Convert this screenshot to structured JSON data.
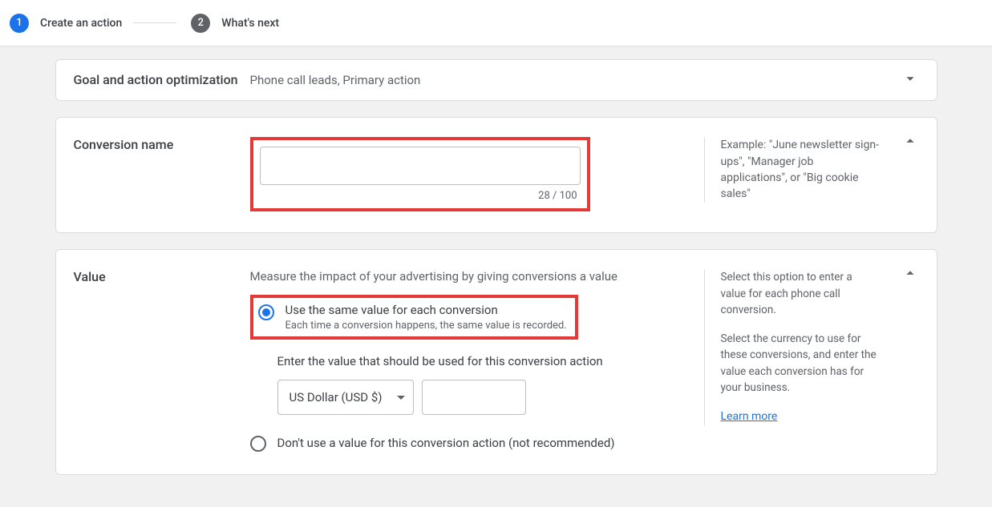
{
  "stepper": {
    "step1": {
      "number": "1",
      "label": "Create an action"
    },
    "step2": {
      "number": "2",
      "label": "What's next"
    }
  },
  "goalCard": {
    "label": "Goal and action optimization",
    "value": "Phone call leads, Primary action"
  },
  "nameCard": {
    "label": "Conversion name",
    "inputValue": "",
    "charCount": "28 / 100",
    "help": "Example: \"June newsletter sign-ups\", \"Manager job applications\", or \"Big cookie sales\""
  },
  "valueCard": {
    "label": "Value",
    "desc": "Measure the impact of your advertising by giving conversions a value",
    "option1": {
      "label": "Use the same value for each conversion",
      "sub": "Each time a conversion happens, the same value is recorded."
    },
    "enterLabel": "Enter the value that should be used for this conversion action",
    "currency": "US Dollar (USD $)",
    "amount": "",
    "option2": {
      "label": "Don't use a value for this conversion action (not recommended)"
    },
    "help1": "Select this option to enter a value for each phone call conversion.",
    "help2": "Select the currency to use for these conversions, and enter the value each conversion has for your business.",
    "learnMore": "Learn more"
  }
}
